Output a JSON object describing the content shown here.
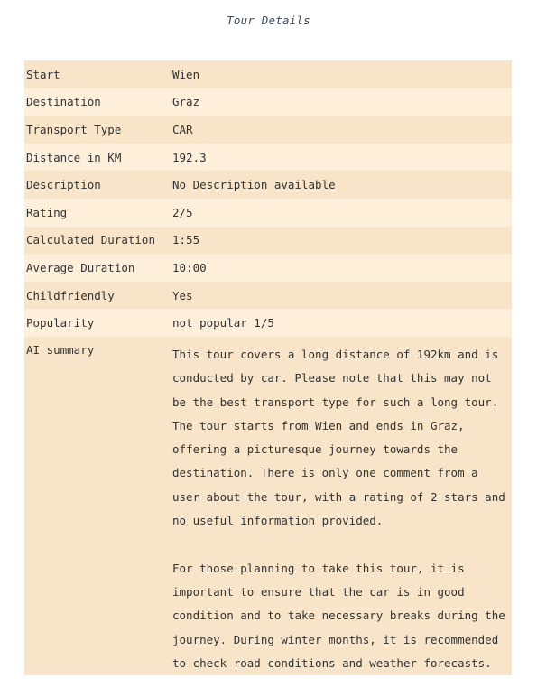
{
  "page": {
    "title": "Tour Details"
  },
  "details": {
    "rows": [
      {
        "label": "Start",
        "value": "Wien"
      },
      {
        "label": "Destination",
        "value": "Graz"
      },
      {
        "label": "Transport Type",
        "value": "CAR"
      },
      {
        "label": "Distance in KM",
        "value": "192.3"
      },
      {
        "label": "Description",
        "value": "No Description available"
      },
      {
        "label": "Rating",
        "value": "2/5"
      },
      {
        "label": "Calculated Duration",
        "value": "1:55"
      },
      {
        "label": "Average Duration",
        "value": "10:00"
      },
      {
        "label": "Childfriendly",
        "value": "Yes"
      },
      {
        "label": "Popularity",
        "value": "not popular 1/5"
      }
    ],
    "ai_summary": {
      "label": "AI summary",
      "paragraphs": [
        "This tour covers a long distance of 192km and is conducted by car. Please note that this may not be the best transport type for such a long tour. The tour starts from Wien and ends in Graz, offering a picturesque journey towards the destination. There is only one comment from a user about the tour, with a rating of 2 stars and no useful information provided.",
        "For those planning to take this tour, it is important to ensure that the car is in good condition and to take necessary breaks during the journey. During winter months, it is recommended to check road conditions and weather forecasts."
      ]
    }
  },
  "colors": {
    "row_odd": "#f8e4c8",
    "row_even": "#fdefda",
    "title": "#3f4a5a",
    "text": "#333333"
  }
}
